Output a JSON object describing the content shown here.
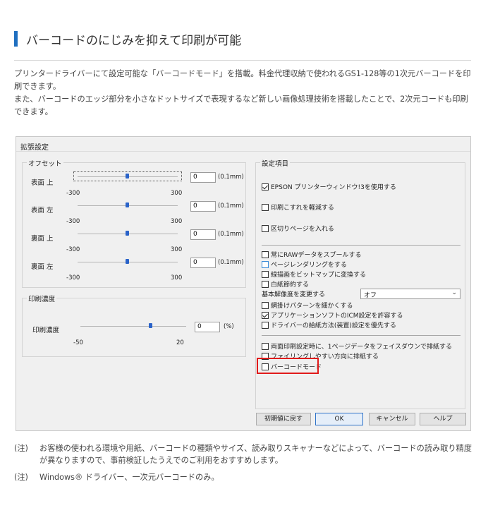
{
  "heading": {
    "title": "バーコードのにじみを抑えて印刷が可能"
  },
  "intro": {
    "para1": "プリンタードライバーにて設定可能な「バーコードモード」を搭載。料金代理収納で使われるGS1-128等の1次元バーコードを印刷できます。",
    "para2": "また、バーコードのエッジ部分を小さなドットサイズで表現するなど新しい画像処理技術を搭載したことで、2次元コードも印刷できます。"
  },
  "dialog": {
    "title": "拡張設定",
    "offset": {
      "label": "オフセット",
      "unit": "(0.1mm)",
      "rows": [
        {
          "label": "表面 上",
          "value": "0",
          "min": "-300",
          "max": "300",
          "position": 0.5
        },
        {
          "label": "表面 左",
          "value": "0",
          "min": "-300",
          "max": "300",
          "position": 0.5
        },
        {
          "label": "裏面 上",
          "value": "0",
          "min": "-300",
          "max": "300",
          "position": 0.5
        },
        {
          "label": "裏面 左",
          "value": "0",
          "min": "-300",
          "max": "300",
          "position": 0.5
        }
      ]
    },
    "density": {
      "label": "印刷濃度",
      "row_label": "印刷濃度",
      "value": "0",
      "unit": "(%)",
      "min": "-50",
      "max": "20",
      "position": 0.714
    },
    "settings": {
      "label": "設定項目",
      "top_options": [
        {
          "label": "EPSON プリンターウィンドウ!3を使用する",
          "checked": true
        },
        {
          "label": "印刷こすれを軽減する",
          "checked": false
        },
        {
          "label": "区切りページを入れる",
          "checked": false
        }
      ],
      "list_options": [
        {
          "label": "常にRAWデータをスプールする",
          "checked": false
        },
        {
          "label": "ページレンダリングをする",
          "checked": false
        },
        {
          "label": "線描画をビットマップに変換する",
          "checked": false
        },
        {
          "label": "白紙節約する",
          "checked": false
        }
      ],
      "resolution": {
        "label": "基本解像度を変更する",
        "selected": "オフ"
      },
      "list_options2": [
        {
          "label": "網掛けパターンを細かくする",
          "checked": false
        },
        {
          "label": "アプリケーションソフトのICM設定を許容する",
          "checked": true
        },
        {
          "label": "ドライバーの給紙方法(装置)設定を優先する",
          "checked": false
        }
      ],
      "bottom_options": [
        {
          "label": "両面印刷設定時に、1ページデータをフェイスダウンで排紙する",
          "checked": false
        },
        {
          "label": "ファイリングしやすい方向に排紙する",
          "checked": false
        },
        {
          "label": "バーコードモード",
          "checked": false
        }
      ]
    },
    "buttons": {
      "reset": "初期値に戻す",
      "ok": "OK",
      "cancel": "キャンセル",
      "help": "ヘルプ"
    }
  },
  "notes": [
    {
      "label": "(注)",
      "text": "お客様の使われる環境や用紙、バーコードの種類やサイズ、読み取りスキャナーなどによって、バーコードの読み取り精度が異なりますので、事前検証したうえでのご利用をおすすめします。"
    },
    {
      "label": "(注)",
      "text": "Windows® ドライバー、一次元バーコードのみ。"
    }
  ],
  "colors": {
    "accent": "#1f6fc0",
    "highlight": "#e11a1a",
    "slider_thumb": "#2a63c9"
  }
}
